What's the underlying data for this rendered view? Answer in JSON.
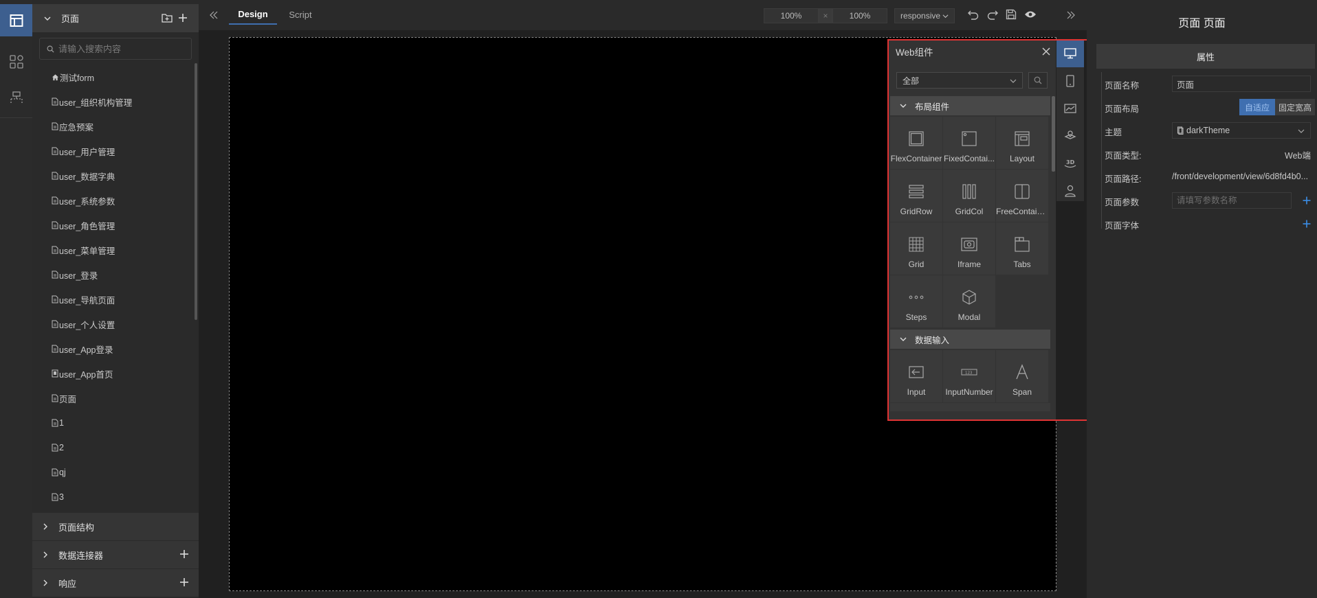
{
  "left_panel": {
    "header_title": "页面",
    "search_placeholder": "请输入搜索内容",
    "pages": [
      {
        "label": "测试form",
        "icon": "home-icon"
      },
      {
        "label": "user_组织机构管理",
        "icon": "page-icon"
      },
      {
        "label": "应急预案",
        "icon": "page-icon"
      },
      {
        "label": "user_用户管理",
        "icon": "page-icon"
      },
      {
        "label": "user_数据字典",
        "icon": "page-icon"
      },
      {
        "label": "user_系统参数",
        "icon": "page-icon"
      },
      {
        "label": "user_角色管理",
        "icon": "page-icon"
      },
      {
        "label": "user_菜单管理",
        "icon": "page-icon"
      },
      {
        "label": "user_登录",
        "icon": "page-icon"
      },
      {
        "label": "user_导航页面",
        "icon": "page-icon"
      },
      {
        "label": "user_个人设置",
        "icon": "page-icon"
      },
      {
        "label": "user_App登录",
        "icon": "page-icon"
      },
      {
        "label": "user_App首页",
        "icon": "mobile-page-icon"
      },
      {
        "label": "页面",
        "icon": "page-icon"
      },
      {
        "label": "1",
        "icon": "page-icon"
      },
      {
        "label": "2",
        "icon": "page-icon"
      },
      {
        "label": "qj",
        "icon": "page-icon"
      },
      {
        "label": "3",
        "icon": "page-icon"
      }
    ],
    "sections": [
      {
        "label": "页面结构",
        "has_add": false
      },
      {
        "label": "数据连接器",
        "has_add": true
      },
      {
        "label": "响应",
        "has_add": true
      }
    ]
  },
  "toolbar": {
    "tabs": [
      "Design",
      "Script"
    ],
    "active_tab": "Design",
    "zoom_a": "100%",
    "zoom_sep": "×",
    "zoom_b": "100%",
    "mode": "responsive"
  },
  "components_panel": {
    "title": "Web组件",
    "filter_value": "全部",
    "categories": [
      {
        "label": "布局组件",
        "items": [
          {
            "label": "FlexContainer",
            "icon": "flex-container-icon"
          },
          {
            "label": "FixedContai...",
            "icon": "fixed-container-icon"
          },
          {
            "label": "Layout",
            "icon": "layout-icon"
          },
          {
            "label": "GridRow",
            "icon": "grid-row-icon"
          },
          {
            "label": "GridCol",
            "icon": "grid-col-icon"
          },
          {
            "label": "FreeContainer",
            "icon": "free-container-icon"
          },
          {
            "label": "Grid",
            "icon": "grid-icon"
          },
          {
            "label": "Iframe",
            "icon": "iframe-icon"
          },
          {
            "label": "Tabs",
            "icon": "tabs-icon"
          },
          {
            "label": "Steps",
            "icon": "steps-icon"
          },
          {
            "label": "Modal",
            "icon": "modal-icon"
          }
        ]
      },
      {
        "label": "数据输入",
        "items": [
          {
            "label": "Input",
            "icon": "input-icon"
          },
          {
            "label": "InputNumber",
            "icon": "input-number-icon"
          },
          {
            "label": "Span",
            "icon": "span-icon"
          }
        ]
      }
    ],
    "side_tabs": [
      "desktop-icon",
      "mobile-icon",
      "chart-icon",
      "map-icon",
      "3d-icon",
      "user-icon"
    ]
  },
  "right_panel": {
    "title": "页面 页面",
    "section": "属性",
    "props": {
      "name_label": "页面名称",
      "name_value": "页面",
      "layout_label": "页面布局",
      "layout_options": [
        "自适应",
        "固定宽高"
      ],
      "layout_selected": "自适应",
      "theme_label": "主题",
      "theme_value": "darkTheme",
      "type_label": "页面类型:",
      "type_value": "Web端",
      "path_label": "页面路径:",
      "path_value": "/front/development/view/6d8fd4b0...",
      "params_label": "页面参数",
      "params_placeholder": "请填写参数名称",
      "font_label": "页面字体"
    }
  },
  "colors": {
    "accent": "#3f6fb0",
    "highlight_border": "#e03434",
    "add_icon": "#3b8ee8"
  }
}
